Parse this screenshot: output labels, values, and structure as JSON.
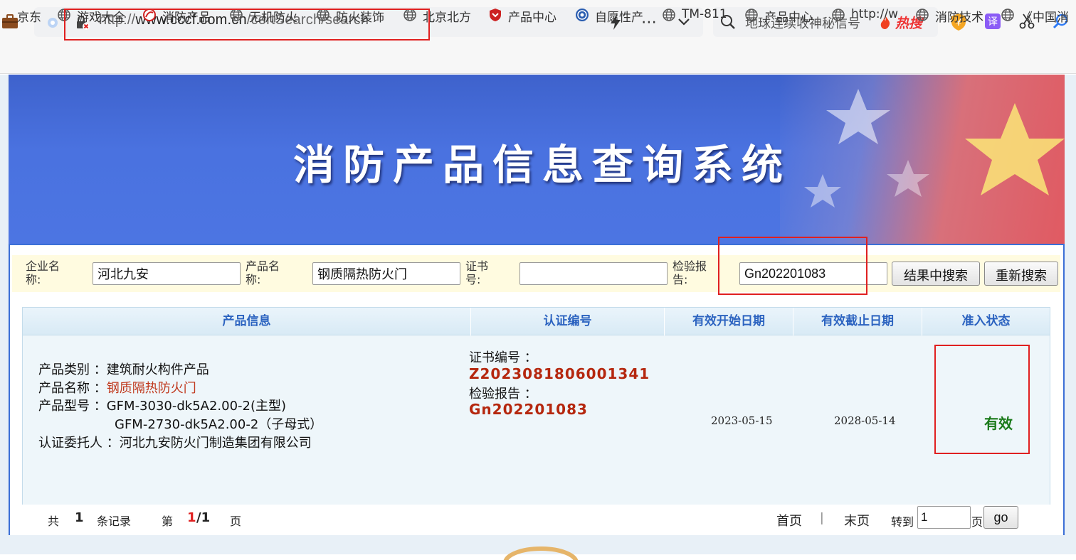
{
  "browser": {
    "url_prefix": "http://",
    "url_domain": "www.cccf.com.cn",
    "url_path": "/certSearch/search",
    "search_text": "地球连续收神秘信号",
    "hot_label": "热搜",
    "bookmarks": [
      {
        "label": "京东"
      },
      {
        "label": "游戏大全"
      },
      {
        "label": "消防产品"
      },
      {
        "label": "无机防火"
      },
      {
        "label": "防火装饰"
      },
      {
        "label": "北京北方"
      },
      {
        "label": "产品中心"
      },
      {
        "label": "自愿性产"
      },
      {
        "label": "TM-811"
      },
      {
        "label": "产品中心"
      },
      {
        "label": "http://w"
      },
      {
        "label": "消防技术"
      },
      {
        "label": "《中国消"
      }
    ]
  },
  "banner": {
    "title": "消防产品信息查询系统"
  },
  "search_form": {
    "company_label": "企业名称:",
    "company_value": "河北九安",
    "product_label": "产品名称:",
    "product_value": "钢质隔热防火门",
    "cert_label": "证书号:",
    "cert_value": "",
    "report_label": "检验报告:",
    "report_value": "Gn202201083",
    "search_in_results_button": "结果中搜索",
    "new_search_button": "重新搜索"
  },
  "table": {
    "headers": [
      "产品信息",
      "认证编号",
      "有效开始日期",
      "有效截止日期",
      "准入状态"
    ],
    "row": {
      "category_label": "产品类别 ：",
      "category_value": "建筑耐火构件产品",
      "name_label": "产品名称 ：",
      "name_value": "钢质隔热防火门",
      "model_label": "产品型号 ：",
      "model_value_1": "GFM-3030-dk5A2.00-2(主型)",
      "model_value_2": "GFM-2730-dk5A2.00-2（子母式）",
      "client_label": "认证委托人 ：",
      "client_value": "河北九安防火门制造集团有限公司",
      "cert_no_label": "证书编号 ：",
      "cert_no_value": "Z2023081806001341",
      "report_label": "检验报告 ：",
      "report_value": "Gn202201083",
      "start_date": "2023-05-15",
      "end_date": "2028-05-14",
      "status": "有效"
    }
  },
  "pager": {
    "total_prefix": "共",
    "total_count": "1",
    "total_suffix": "条记录",
    "page_prefix": "第",
    "page_current": "1",
    "page_total": "/1",
    "page_suffix": "页",
    "first_page": "首页",
    "separator": "|",
    "last_page": "末页",
    "goto_label": "转到",
    "goto_value": "1",
    "goto_suffix": "页",
    "go_button": "go"
  }
}
